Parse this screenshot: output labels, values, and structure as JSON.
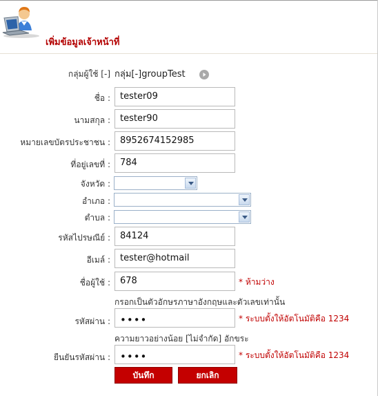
{
  "page": {
    "title": "เพิ่มข้อมูลเจ้าหน้าที่"
  },
  "group": {
    "label": "กลุ่มผู้ใช้ [-]",
    "value": "กลุ่ม[-]groupTest"
  },
  "fields": {
    "first_name": {
      "label": "ชื่อ :",
      "value": "tester09"
    },
    "last_name": {
      "label": "นามสกุล :",
      "value": "tester90"
    },
    "id_card": {
      "label": "หมายเลขบัตรประชาชน :",
      "value": "8952674152985"
    },
    "address_no": {
      "label": "ที่อยู่เลขที่ :",
      "value": "784"
    },
    "province": {
      "label": "จังหวัด :",
      "value": ""
    },
    "district": {
      "label": "อำเภอ :",
      "value": ""
    },
    "subdistrict": {
      "label": "ตำบล :",
      "value": ""
    },
    "postcode": {
      "label": "รหัสไปรษณีย์ :",
      "value": "84124"
    },
    "email": {
      "label": "อีเมล์ :",
      "value": "tester@hotmail"
    },
    "username": {
      "label": "ชื่อผู้ใช้ :",
      "value": "678",
      "required_note": "* ห้ามว่าง",
      "hint": "กรอกเป็นตัวอักษรภาษาอังกฤษและตัวเลขเท่านั้น"
    },
    "password": {
      "label": "รหัสผ่าน :",
      "value": "••••",
      "note": "* ระบบตั้งให้อัตโนมัติคือ 1234",
      "hint": "ความยาวอย่างน้อย [ไม่จำกัด] อักขระ"
    },
    "confirm_password": {
      "label": "ยืนยันรหัสผ่าน :",
      "value": "••••",
      "note": "* ระบบตั้งให้อัตโนมัติคือ 1234"
    }
  },
  "buttons": {
    "save": "บันทึก",
    "cancel": "ยกเลิก"
  },
  "colors": {
    "title": "#b30000",
    "required": "#c00000",
    "button_bg": "#c40000"
  },
  "icons": {
    "header": "user-at-laptop-icon",
    "group_go": "go-arrow-icon"
  }
}
